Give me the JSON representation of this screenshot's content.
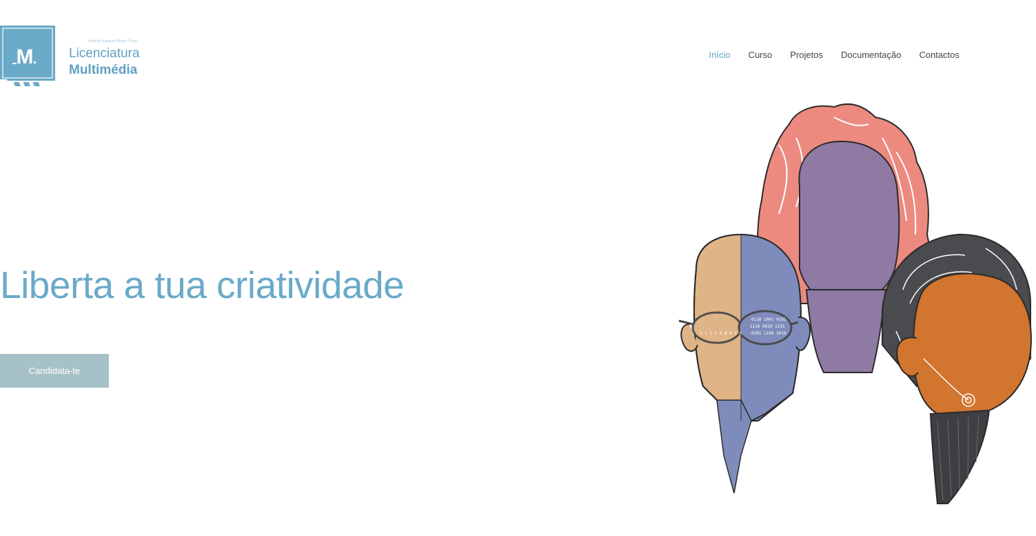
{
  "logo": {
    "mark_letter": "M",
    "institution": "Instituto Superior Miguel Torga",
    "line1": "Licenciatura",
    "line2": "Multimédia"
  },
  "nav": {
    "items": [
      {
        "label": "Início",
        "active": true
      },
      {
        "label": "Curso",
        "active": false
      },
      {
        "label": "Projetos",
        "active": false
      },
      {
        "label": "Documentação",
        "active": false
      },
      {
        "label": "Contactos",
        "active": false
      }
    ]
  },
  "hero": {
    "title": "Liberta a tua criatividade",
    "cta_label": "Candidata-te"
  },
  "colors": {
    "accent": "#5fa2c3",
    "button": "#a7c1c8",
    "nav_text": "#444444"
  },
  "illustration": {
    "name": "three-faces-illustration",
    "glasses_text": [
      "0110 1001 0101",
      "1110 0010 1101",
      "0101 1100 1010",
      "1 1 1 1 0 0 0 1 0"
    ]
  }
}
